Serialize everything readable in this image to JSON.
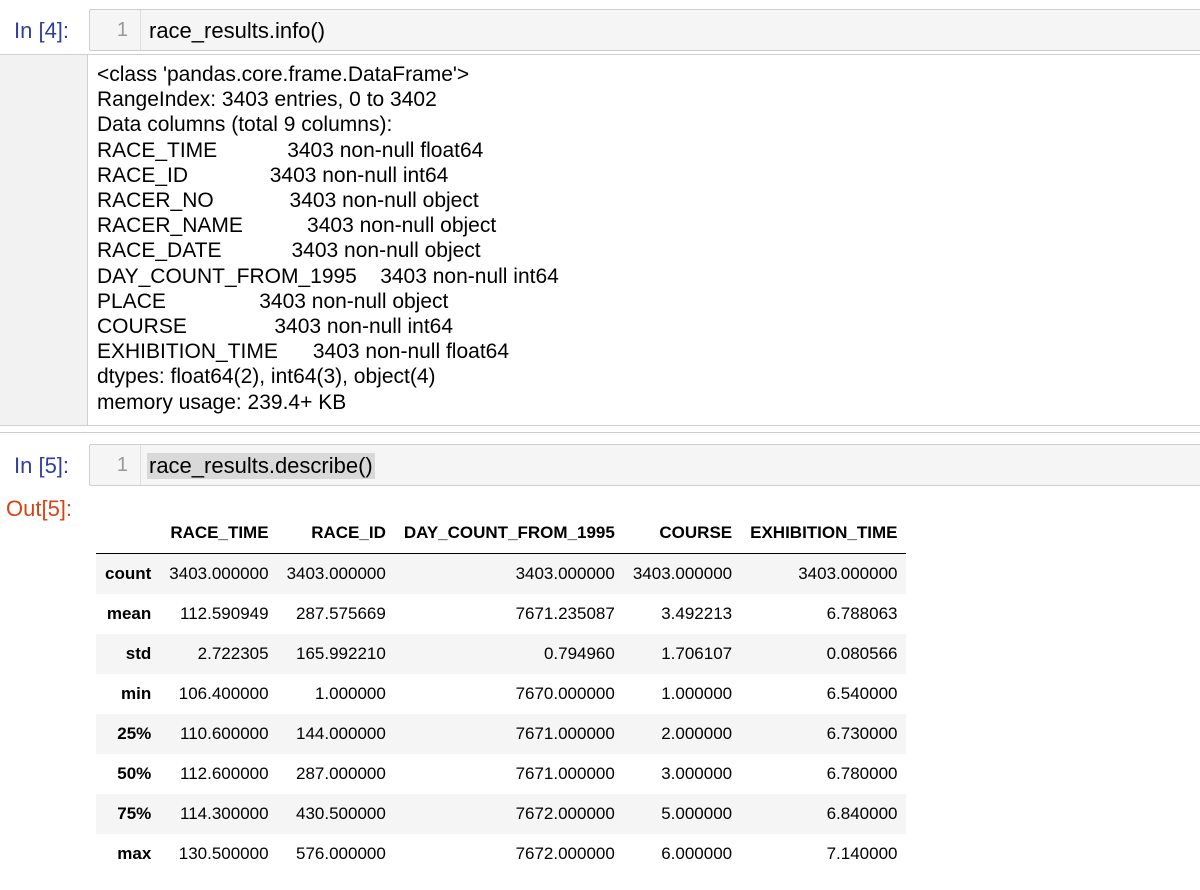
{
  "cell4": {
    "prompt": "In [4]:",
    "line_number": "1",
    "code": "race_results.info()",
    "output_lines": [
      "<class 'pandas.core.frame.DataFrame'>",
      "RangeIndex: 3403 entries, 0 to 3402",
      "Data columns (total 9 columns):",
      "RACE_TIME            3403 non-null float64",
      "RACE_ID              3403 non-null int64",
      "RACER_NO             3403 non-null object",
      "RACER_NAME           3403 non-null object",
      "RACE_DATE            3403 non-null object",
      "DAY_COUNT_FROM_1995    3403 non-null int64",
      "PLACE                3403 non-null object",
      "COURSE               3403 non-null int64",
      "EXHIBITION_TIME      3403 non-null float64",
      "dtypes: float64(2), int64(3), object(4)",
      "memory usage: 239.4+ KB"
    ]
  },
  "cell5": {
    "prompt": "In [5]:",
    "line_number": "1",
    "code": "race_results.describe()",
    "out_prompt": "Out[5]:",
    "table": {
      "columns": [
        "",
        "RACE_TIME",
        "RACE_ID",
        "DAY_COUNT_FROM_1995",
        "COURSE",
        "EXHIBITION_TIME"
      ],
      "rows": [
        [
          "count",
          "3403.000000",
          "3403.000000",
          "3403.000000",
          "3403.000000",
          "3403.000000"
        ],
        [
          "mean",
          "112.590949",
          "287.575669",
          "7671.235087",
          "3.492213",
          "6.788063"
        ],
        [
          "std",
          "2.722305",
          "165.992210",
          "0.794960",
          "1.706107",
          "0.080566"
        ],
        [
          "min",
          "106.400000",
          "1.000000",
          "7670.000000",
          "1.000000",
          "6.540000"
        ],
        [
          "25%",
          "110.600000",
          "144.000000",
          "7671.000000",
          "2.000000",
          "6.730000"
        ],
        [
          "50%",
          "112.600000",
          "287.000000",
          "7671.000000",
          "3.000000",
          "6.780000"
        ],
        [
          "75%",
          "114.300000",
          "430.500000",
          "7672.000000",
          "5.000000",
          "6.840000"
        ],
        [
          "max",
          "130.500000",
          "576.000000",
          "7672.000000",
          "6.000000",
          "7.140000"
        ]
      ]
    }
  }
}
